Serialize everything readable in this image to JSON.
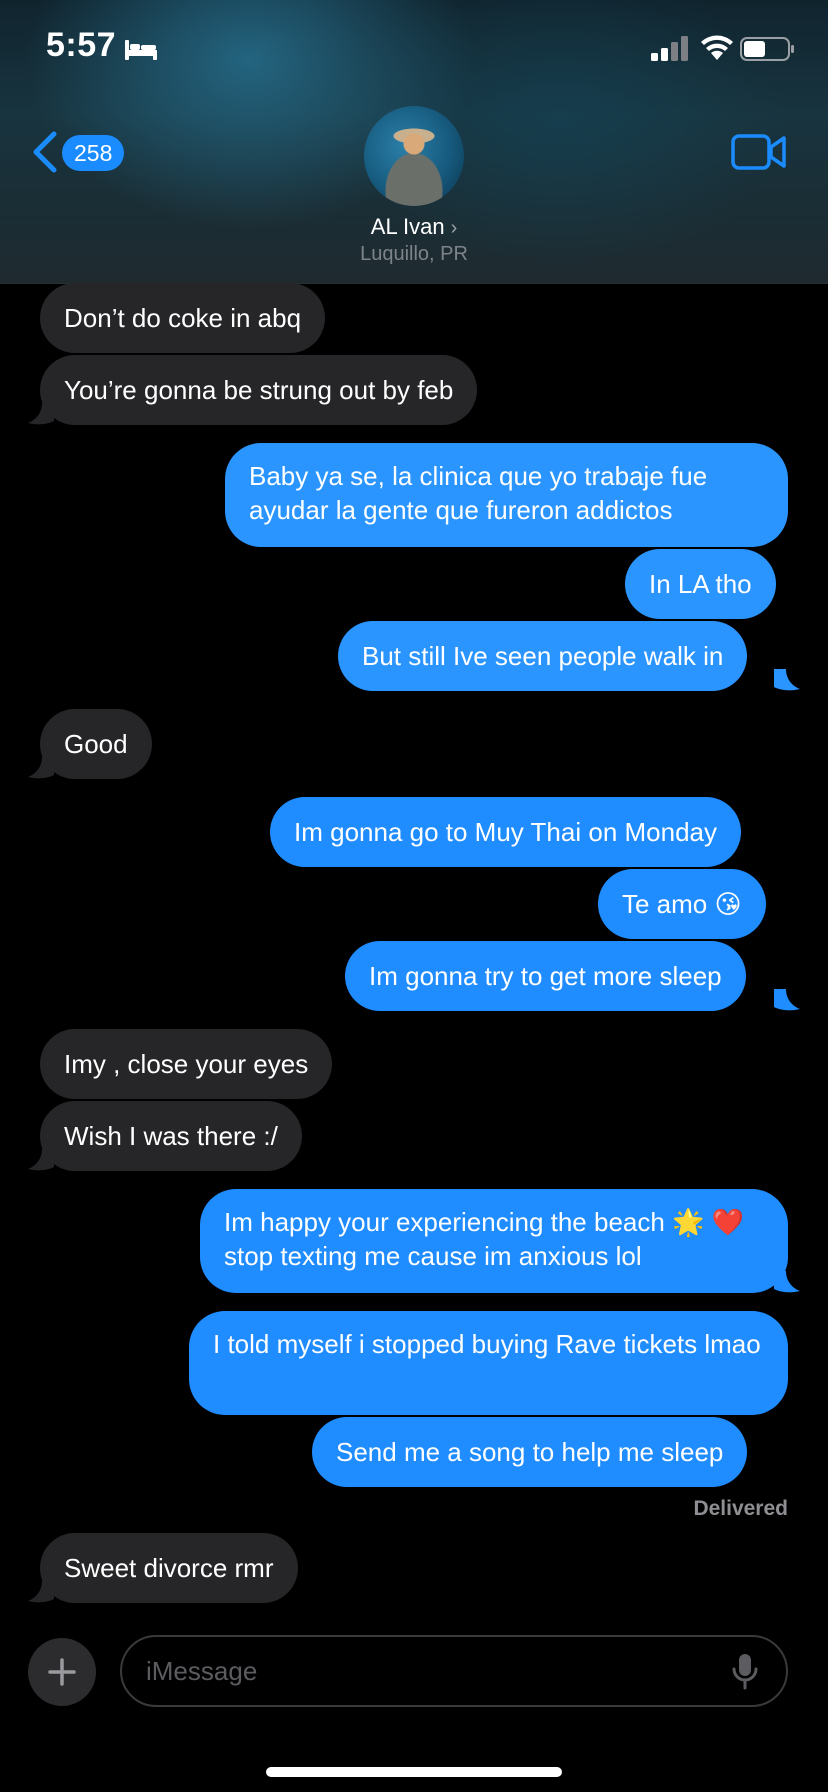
{
  "status_bar": {
    "time": "5:57"
  },
  "header": {
    "back_count": "258",
    "contact_name": "AL Ivan",
    "contact_chevron": "›",
    "contact_location": "Luquillo, PR"
  },
  "messages": [
    {
      "dir": "in",
      "text": "Don’t do coke in abq"
    },
    {
      "dir": "in",
      "text": "You’re gonna be strung out by feb"
    },
    {
      "dir": "out",
      "text": "Baby ya se, la clinica que yo trabaje fue ayudar la gente que fureron addictos"
    },
    {
      "dir": "out",
      "text": "In LA tho"
    },
    {
      "dir": "out",
      "text": "But still Ive seen people walk in"
    },
    {
      "dir": "in",
      "text": "Good"
    },
    {
      "dir": "out",
      "text": "Im gonna go to Muy Thai on Monday"
    },
    {
      "dir": "out",
      "text": "Te amo 😘"
    },
    {
      "dir": "out",
      "text": "Im gonna try to get more sleep"
    },
    {
      "dir": "in",
      "text": "Imy , close your eyes"
    },
    {
      "dir": "in",
      "text": "Wish I was there :/"
    },
    {
      "dir": "out",
      "text": "Im happy your experiencing the beach 🌟 ❤️ stop texting me cause im anxious lol"
    },
    {
      "dir": "out",
      "text": "I told myself i stopped buying Rave tickets lmao"
    },
    {
      "dir": "out",
      "text": "Send me a song to help me sleep"
    },
    {
      "dir": "in",
      "text": "Sweet divorce rmr"
    }
  ],
  "receipt": "Delivered",
  "composer": {
    "placeholder": "iMessage",
    "value": ""
  },
  "colors": {
    "incoming_bubble": "#262628",
    "outgoing_bubble": "#1f8cff",
    "accent": "#1a8cff",
    "background": "#000000"
  },
  "icons": {
    "status": [
      "bed-icon",
      "signal-icon",
      "wifi-icon",
      "battery-icon"
    ],
    "header": [
      "back-chevron-icon",
      "video-camera-icon"
    ],
    "composer": [
      "plus-icon",
      "microphone-icon"
    ]
  }
}
